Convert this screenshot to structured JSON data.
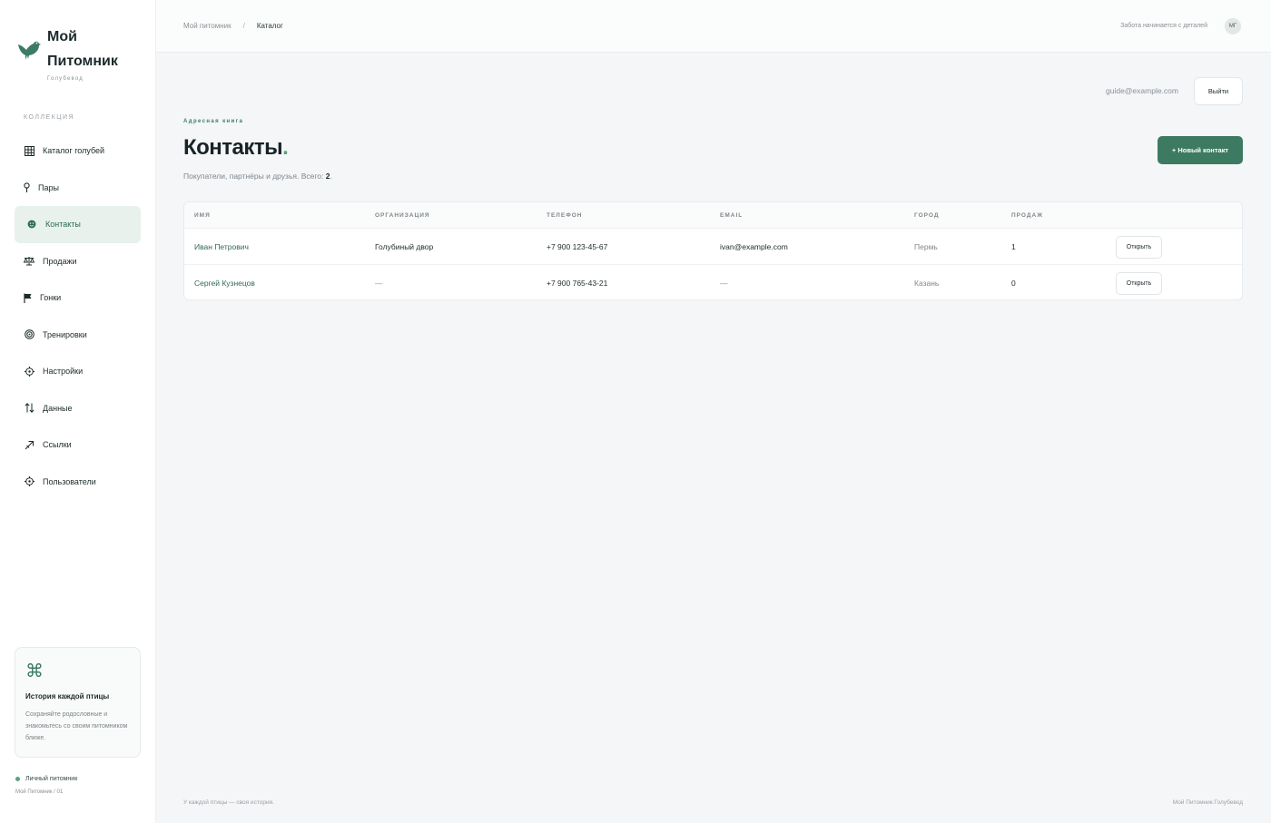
{
  "brand": {
    "name": "Мой Питомник",
    "subtitle": "Голубевод"
  },
  "sidebar": {
    "section_label": "КОЛЛЕКЦИЯ",
    "items": [
      {
        "label": "Каталог голубей",
        "icon": "grid-icon"
      },
      {
        "label": "Пары",
        "icon": "pin-icon"
      },
      {
        "label": "Контакты",
        "icon": "contacts-icon",
        "active": true
      },
      {
        "label": "Продажи",
        "icon": "scales-icon"
      },
      {
        "label": "Гонки",
        "icon": "flag-icon"
      },
      {
        "label": "Тренировки",
        "icon": "target-icon"
      },
      {
        "label": "Настройки",
        "icon": "settings-icon"
      },
      {
        "label": "Данные",
        "icon": "sort-arrows-icon"
      },
      {
        "label": "Ссылки",
        "icon": "link-arrow-icon"
      },
      {
        "label": "Пользователи",
        "icon": "users-icon"
      }
    ],
    "promo": {
      "icon": "command-icon",
      "title": "История каждой птицы",
      "text": "Сохраняйте родословные и знакомьтесь со своим питомником ближе."
    },
    "footer": {
      "status": "Личный питомник",
      "version": "Мой Питомник / 01"
    }
  },
  "topbar": {
    "breadcrumb": [
      "Мой питомник",
      "Каталог"
    ],
    "separator": "/",
    "tagline": "Забота начинается с деталей",
    "avatar_initials": "МГ"
  },
  "user": {
    "email": "guide@example.com",
    "logout_label": "Выйти"
  },
  "header": {
    "eyebrow": "Адресная книга",
    "title": "Контакты",
    "title_dot": ".",
    "subtitle_prefix": "Покупатели, партнёры и друзья. Всего: ",
    "total": "2",
    "subtitle_suffix": ".",
    "new_button": "+ Новый контакт"
  },
  "table": {
    "columns": [
      "ИМЯ",
      "ОРГАНИЗАЦИЯ",
      "ТЕЛЕФОН",
      "EMAIL",
      "ГОРОД",
      "ПРОДАЖ"
    ],
    "rows": [
      {
        "name": "Иван Петрович",
        "org": "Голубиный двор",
        "phone": "+7 900 123-45-67",
        "email": "ivan@example.com",
        "city": "Пермь",
        "sales": "1",
        "action": "Открыть"
      },
      {
        "name": "Сергей Кузнецов",
        "org": "—",
        "phone": "+7 900 765-43-21",
        "email": "—",
        "city": "Казань",
        "sales": "0",
        "action": "Открыть"
      }
    ]
  },
  "footer": {
    "left": "У каждой птицы — своя история.",
    "right": "Мой Питомник.Голубевод"
  },
  "colors": {
    "accent": "#3c7a62",
    "active_bg": "#e8f1ec",
    "background": "#f4f6f8"
  }
}
